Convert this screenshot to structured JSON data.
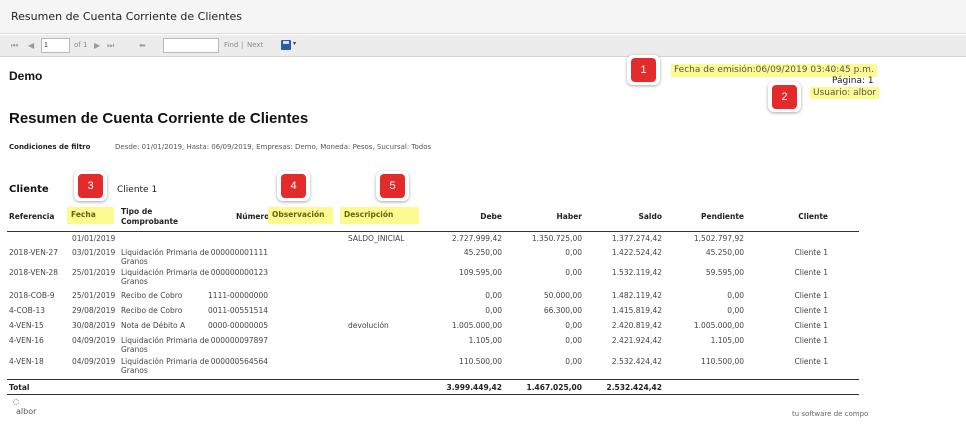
{
  "window": {
    "title": "Resumen de Cuenta Corriente de Clientes"
  },
  "toolbar": {
    "first_icon": "⏮",
    "prev_icon": "◀",
    "page_value": "1",
    "page_of": "of 1",
    "next_icon": "▶",
    "last_icon": "⏭",
    "back_icon": "⬅",
    "find_value": "",
    "find_label": "Find",
    "separator": "|",
    "next_label": "Next",
    "save_icon": "save-icon",
    "dropdown_icon": "▾"
  },
  "header": {
    "company": "Demo",
    "emission": "Fecha de emisión:06/09/2019 03:40:45 p.m.",
    "page": "Página: 1",
    "user": "Usuario: albor"
  },
  "report": {
    "title": "Resumen de Cuenta Corriente de Clientes",
    "filter_label": "Condiciones de filtro",
    "filter_value": "Desde: 01/01/2019, Hasta: 06/09/2019, Empresas: Demo, Moneda: Pesos, Sucursal: Todos",
    "client_label": "Cliente",
    "client_value": "Cliente 1"
  },
  "table": {
    "headers": {
      "referencia": "Referencia",
      "fecha": "Fecha",
      "tipo_line1": "Tipo de",
      "tipo_line2": "Comprobante",
      "numero": "Número",
      "observacion": "Observación",
      "descripcion": "Descripción",
      "debe": "Debe",
      "haber": "Haber",
      "saldo": "Saldo",
      "pendiente": "Pendiente",
      "cliente": "Cliente"
    },
    "rows": [
      {
        "ref": "",
        "fecha": "01/01/2019",
        "tipo1": "",
        "tipo2": "",
        "numero": "",
        "obs": "",
        "desc": "SALDO_INICIAL",
        "debe": "2.727.999,42",
        "haber": "1.350.725,00",
        "saldo": "1.377.274,42",
        "pend": "1.502.797,92",
        "cliente": ""
      },
      {
        "ref": "2018-VEN-27",
        "fecha": "03/01/2019",
        "tipo1": "Liquidación Primaria de",
        "tipo2": "Granos",
        "numero": "000000001111",
        "obs": "",
        "desc": "",
        "debe": "45.250,00",
        "haber": "0,00",
        "saldo": "1.422.524,42",
        "pend": "45.250,00",
        "cliente": "Cliente 1"
      },
      {
        "ref": "2018-VEN-28",
        "fecha": "25/01/2019",
        "tipo1": "Liquidación Primaria de",
        "tipo2": "Granos",
        "numero": "000000000123",
        "obs": "",
        "desc": "",
        "debe": "109.595,00",
        "haber": "0,00",
        "saldo": "1.532.119,42",
        "pend": "59.595,00",
        "cliente": "Cliente 1"
      },
      {
        "ref": "2018-COB-9",
        "fecha": "25/01/2019",
        "tipo1": "Recibo de Cobro",
        "tipo2": "",
        "numero": "1111-00000000",
        "obs": "",
        "desc": "",
        "debe": "0,00",
        "haber": "50.000,00",
        "saldo": "1.482.119,42",
        "pend": "0,00",
        "cliente": "Cliente 1"
      },
      {
        "ref": "4-COB-13",
        "fecha": "29/08/2019",
        "tipo1": "Recibo de Cobro",
        "tipo2": "",
        "numero": "0011-00551514",
        "obs": "",
        "desc": "",
        "debe": "0,00",
        "haber": "66.300,00",
        "saldo": "1.415.819,42",
        "pend": "0,00",
        "cliente": "Cliente 1"
      },
      {
        "ref": "4-VEN-15",
        "fecha": "30/08/2019",
        "tipo1": "Nota de Débito A",
        "tipo2": "",
        "numero": "0000-00000005",
        "obs": "devolución",
        "desc": "",
        "debe": "1.005.000,00",
        "haber": "0,00",
        "saldo": "2.420.819,42",
        "pend": "1.005.000,00",
        "cliente": "Cliente 1"
      },
      {
        "ref": "4-VEN-16",
        "fecha": "04/09/2019",
        "tipo1": "Liquidación Primaria de",
        "tipo2": "Granos",
        "numero": "000000097897",
        "obs": "",
        "desc": "",
        "debe": "1.105,00",
        "haber": "0,00",
        "saldo": "2.421.924,42",
        "pend": "1.105,00",
        "cliente": "Cliente 1"
      },
      {
        "ref": "4-VEN-18",
        "fecha": "04/09/2019",
        "tipo1": "Liquidación Primaria de",
        "tipo2": "Granos",
        "numero": "000000564564",
        "obs": "",
        "desc": "",
        "debe": "110.500,00",
        "haber": "0,00",
        "saldo": "2.532.424,42",
        "pend": "110.500,00",
        "cliente": "Cliente 1"
      }
    ],
    "total": {
      "label": "Total",
      "debe": "3.999.449,42",
      "haber": "1.467.025,00",
      "saldo": "2.532.424,42"
    }
  },
  "callouts": [
    "1",
    "2",
    "3",
    "4",
    "5"
  ],
  "footer": {
    "logo_text": "albor",
    "tagline": "tu software de compo"
  }
}
